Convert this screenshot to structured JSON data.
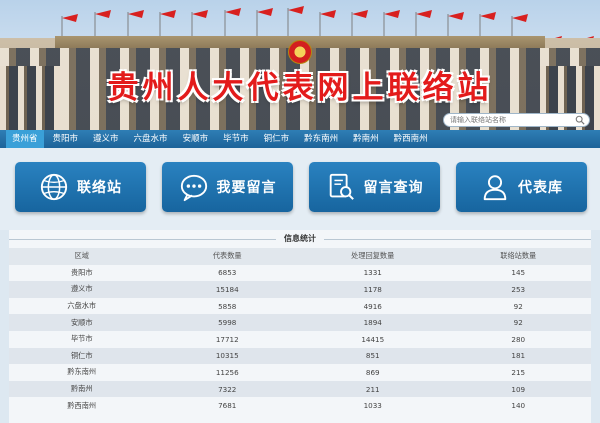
{
  "header": {
    "site_title": "贵州人大代表网上联络站",
    "search_placeholder": "请输入联络站名称"
  },
  "nav": {
    "items": [
      "贵州省",
      "贵阳市",
      "遵义市",
      "六盘水市",
      "安顺市",
      "毕节市",
      "铜仁市",
      "黔东南州",
      "黔南州",
      "黔西南州"
    ],
    "active_index": 0
  },
  "actions": {
    "liaison_station": "联络站",
    "leave_message": "我要留言",
    "message_query": "留言查询",
    "representative_db": "代表库"
  },
  "stats": {
    "title": "信息统计",
    "columns": [
      "区域",
      "代表数量",
      "处理回复数量",
      "联络站数量"
    ],
    "rows": [
      [
        "贵阳市",
        "6853",
        "1331",
        "145"
      ],
      [
        "遵义市",
        "15184",
        "1178",
        "253"
      ],
      [
        "六盘水市",
        "5858",
        "4916",
        "92"
      ],
      [
        "安顺市",
        "5998",
        "1894",
        "92"
      ],
      [
        "毕节市",
        "17712",
        "14415",
        "280"
      ],
      [
        "铜仁市",
        "10315",
        "851",
        "181"
      ],
      [
        "黔东南州",
        "11256",
        "869",
        "215"
      ],
      [
        "黔南州",
        "7322",
        "211",
        "109"
      ],
      [
        "黔西南州",
        "7681",
        "1033",
        "140"
      ]
    ]
  },
  "colors": {
    "title_red": "#e31b1b",
    "nav_blue": "#1d6399",
    "nav_active": "#3aa0d8",
    "button_blue": "#1a6aa6"
  }
}
